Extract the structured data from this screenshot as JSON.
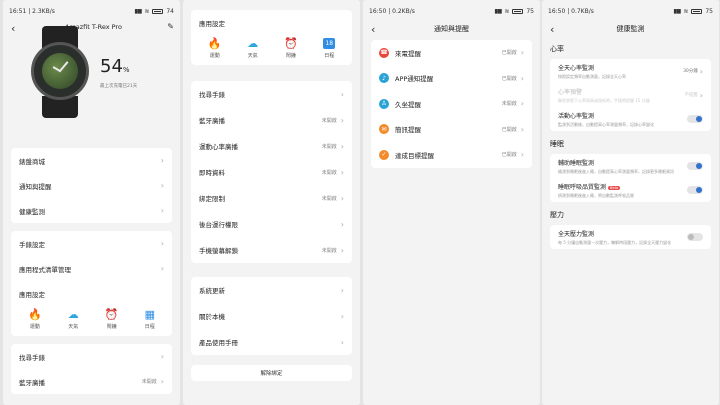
{
  "screens": [
    {
      "status_time": "16:51",
      "status_speed": "2.3KB/s",
      "battery": "74",
      "title": "Amazfit T-Rex Pro",
      "battery_percent": "54",
      "percent_sign": "%",
      "last_charged": "最上次充電已21天",
      "menu1": [
        "錶盤商城",
        "通知與提醒",
        "健康監測"
      ],
      "menu2": [
        "手錶設定",
        "應用程式清單管理"
      ],
      "app_settings_label": "應用設定",
      "apps": [
        {
          "label": "運動",
          "icon": "fire-icon",
          "color": "#e8473a"
        },
        {
          "label": "天氣",
          "icon": "cloud-icon",
          "color": "#2ea7e0"
        },
        {
          "label": "鬧鐘",
          "icon": "alarm-icon",
          "color": "#e8473a"
        },
        {
          "label": "日程",
          "icon": "calendar-icon",
          "color": "#2f8de4"
        }
      ],
      "menu3": [
        {
          "label": "找尋手錶",
          "value": ""
        },
        {
          "label": "藍牙廣播",
          "value": "未開啟"
        }
      ]
    },
    {
      "app_settings_label": "應用設定",
      "apps": [
        {
          "label": "運動"
        },
        {
          "label": "天氣"
        },
        {
          "label": "鬧鐘"
        },
        {
          "label": "日程"
        }
      ],
      "calendar_num": "18",
      "menu_a": [
        {
          "label": "找尋手錶",
          "value": ""
        },
        {
          "label": "藍牙廣播",
          "value": "未開啟"
        },
        {
          "label": "運動心率廣播",
          "value": "未開啟"
        },
        {
          "label": "即時資料",
          "value": "未開啟"
        },
        {
          "label": "綁定限制",
          "value": "未開啟"
        },
        {
          "label": "後台運行權限",
          "value": ""
        },
        {
          "label": "手機螢幕解鎖",
          "value": "未開啟"
        }
      ],
      "menu_b": [
        {
          "label": "系統更新"
        },
        {
          "label": "關於本機"
        },
        {
          "label": "產品使用手冊"
        }
      ],
      "unbind_label": "解除綁定"
    },
    {
      "status_time": "16:50",
      "status_speed": "0.2KB/s",
      "battery": "75",
      "title": "通知與提醒",
      "items": [
        {
          "label": "來電提醒",
          "value": "已開啟",
          "color": "#e8473a",
          "glyph": "☎",
          "icon": "phone-icon"
        },
        {
          "label": "APP通知提醒",
          "value": "已開啟",
          "color": "#2aa3d6",
          "glyph": "♪",
          "icon": "bell-icon"
        },
        {
          "label": "久坐提醒",
          "value": "未開啟",
          "color": "#2aa3d6",
          "glyph": "♙",
          "icon": "sit-icon"
        },
        {
          "label": "簡訊提醒",
          "value": "已開啟",
          "color": "#f28b2c",
          "glyph": "✉",
          "icon": "message-icon"
        },
        {
          "label": "達成目標提醒",
          "value": "已開啟",
          "color": "#f28b2c",
          "glyph": "✓",
          "icon": "goal-icon"
        }
      ]
    },
    {
      "status_time": "16:50",
      "status_speed": "0.7KB/s",
      "battery": "75",
      "title": "健康監測",
      "sections": [
        {
          "title": "心率",
          "rows": [
            {
              "label": "全天心率監測",
              "desc": "按照設定頻率自動測量，記錄全天心率",
              "value": "30分鐘",
              "control": "value",
              "dim": false
            },
            {
              "label": "心率預警",
              "desc": "靜息狀態下心率過高或過低時，手錶將提醒 15 分鐘",
              "value": "不提醒",
              "control": "value",
              "dim": true
            },
            {
              "label": "活動心率監測",
              "desc": "監測到活動後，自動提高心率測量頻率，記錄心率變化",
              "value": "",
              "control": "toggle-on",
              "dim": false
            }
          ]
        },
        {
          "title": "睡眠",
          "rows": [
            {
              "label": "輔助睡眠監測",
              "desc": "檢測到睡眠後進入睡，自動提高心率測量頻率，記錄更多睡眠資訊",
              "value": "",
              "control": "toggle-on",
              "dim": false,
              "beta": ""
            },
            {
              "label": "睡眠呼吸品質監測",
              "desc": "偵測到睡眠後進入睡，將自動監測呼吸品質",
              "value": "",
              "control": "toggle-on",
              "dim": false,
              "beta": "Beta"
            }
          ]
        },
        {
          "title": "壓力",
          "rows": [
            {
              "label": "全天壓力監測",
              "desc": "每 5 分鐘自動測量一次壓力，瞭解時段壓力，記錄全天壓力變化",
              "value": "",
              "control": "toggle-off",
              "dim": false
            }
          ]
        }
      ]
    }
  ]
}
